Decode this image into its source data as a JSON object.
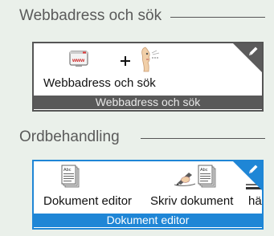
{
  "sections": [
    {
      "title": "Webbadress och sök",
      "tile": {
        "items": [
          {
            "label": "Webbadress och sök",
            "icons": [
              "www-icon",
              "plus-icon",
              "face-icon"
            ]
          }
        ],
        "footer": "Webbadress och sök",
        "edit_icon": "pencil-icon",
        "color": "#595959"
      }
    },
    {
      "title": "Ordbehandling",
      "tile": {
        "items": [
          {
            "label": "Dokument editor",
            "icon": "document-icon"
          },
          {
            "label": "Skriv dokument",
            "icon": "writing-hand-icon"
          },
          {
            "label": "hä",
            "icon": "document-icon"
          }
        ],
        "icon_text": "Abc",
        "footer": "Dokument editor",
        "edit_icon": "pencil-icon",
        "color": "#1f86d6"
      }
    }
  ]
}
